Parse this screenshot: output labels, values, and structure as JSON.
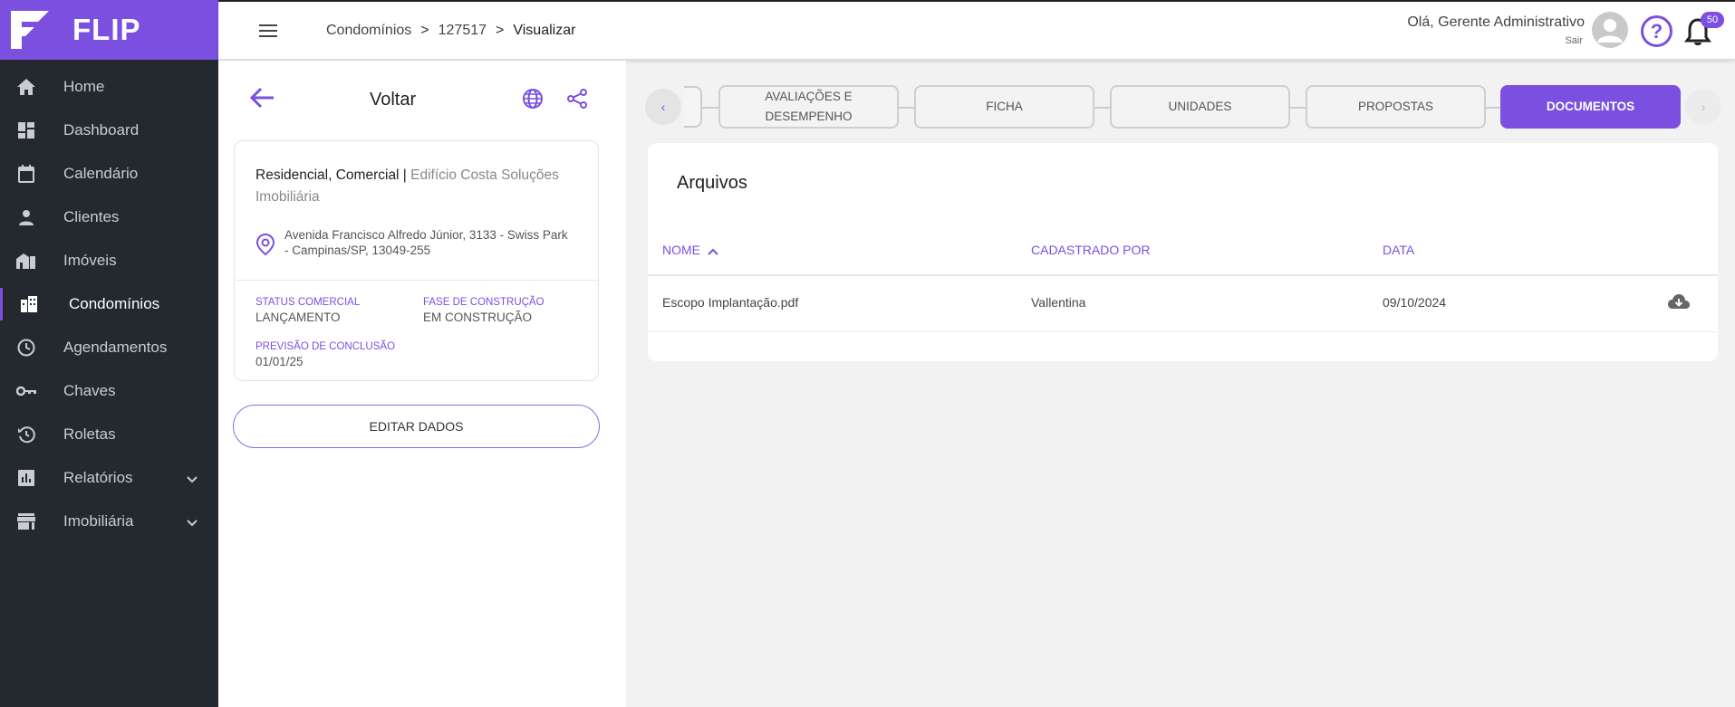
{
  "app": {
    "name": "FLIP"
  },
  "colors": {
    "accent": "#7b4fe0",
    "sidebar_bg": "#23292e"
  },
  "sidebar": {
    "items": [
      {
        "label": "Home",
        "icon": "home-icon"
      },
      {
        "label": "Dashboard",
        "icon": "dashboard-icon"
      },
      {
        "label": "Calendário",
        "icon": "calendar-icon"
      },
      {
        "label": "Clientes",
        "icon": "person-icon"
      },
      {
        "label": "Imóveis",
        "icon": "house-icon"
      },
      {
        "label": "Condomínios",
        "icon": "building-icon",
        "active": true
      },
      {
        "label": "Agendamentos",
        "icon": "clock-icon"
      },
      {
        "label": "Chaves",
        "icon": "key-icon"
      },
      {
        "label": "Roletas",
        "icon": "roulette-icon"
      },
      {
        "label": "Relatórios",
        "icon": "chart-icon",
        "expandable": true
      },
      {
        "label": "Imobiliária",
        "icon": "store-icon",
        "expandable": true
      }
    ]
  },
  "header": {
    "breadcrumb": [
      "Condomínios",
      "127517",
      "Visualizar"
    ],
    "greeting": "Olá, Gerente Administrativo",
    "logout": "Sair",
    "notification_count": "50"
  },
  "panel": {
    "back_label": "Voltar",
    "card": {
      "type": "Residencial, Comercial |",
      "name": "Edifício Costa Soluções Imobiliária",
      "address": "Avenida Francisco Alfredo Júnior, 3133 - Swiss Park - Campinas/SP, 13049-255",
      "status_label": "STATUS COMERCIAL",
      "status_value": "LANÇAMENTO",
      "phase_label": "FASE DE CONSTRUÇÃO",
      "phase_value": "EM CONSTRUÇÃO",
      "forecast_label": "PREVISÃO DE CONCLUSÃO",
      "forecast_value": "01/01/25"
    },
    "edit_label": "EDITAR DADOS"
  },
  "tabs": [
    {
      "label": "AVALIAÇÕES E DESEMPENHO"
    },
    {
      "label": "FICHA"
    },
    {
      "label": "UNIDADES"
    },
    {
      "label": "PROPOSTAS"
    },
    {
      "label": "DOCUMENTOS",
      "active": true
    }
  ],
  "files": {
    "title": "Arquivos",
    "columns": [
      "NOME",
      "CADASTRADO POR",
      "DATA"
    ],
    "rows": [
      {
        "name": "Escopo Implantação.pdf",
        "by": "Vallentina",
        "date": "09/10/2024"
      }
    ]
  }
}
